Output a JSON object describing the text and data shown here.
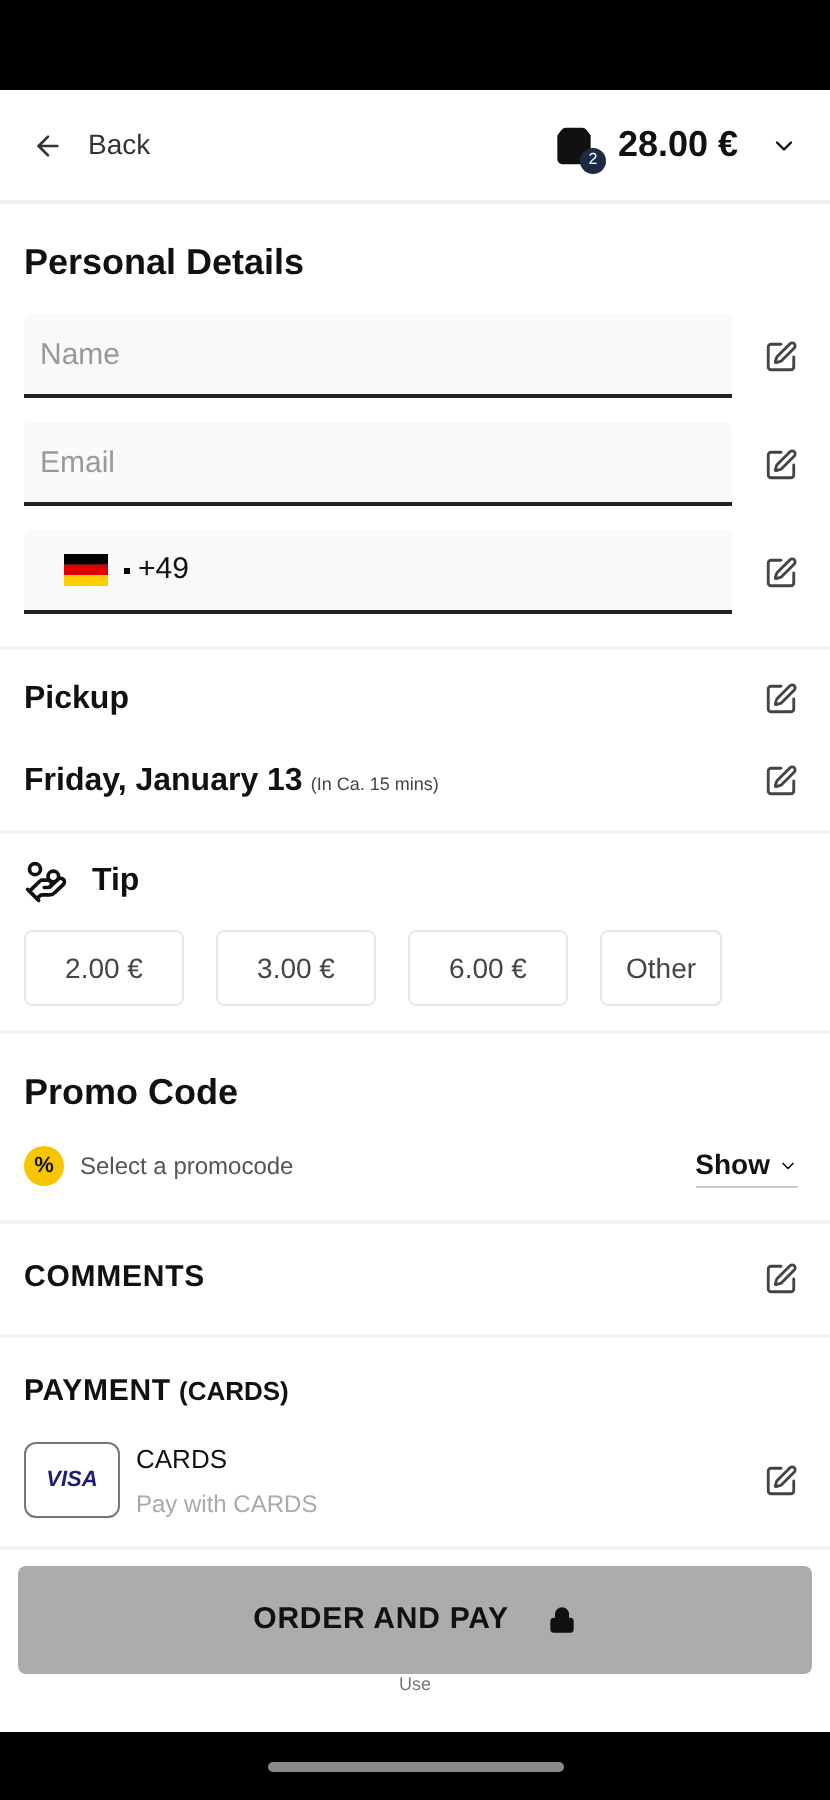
{
  "header": {
    "back": "Back",
    "cart_count": "2",
    "total": "28.00 €"
  },
  "personal": {
    "title": "Personal Details",
    "fields": [
      {
        "kind": "text",
        "placeholder": "Name"
      },
      {
        "kind": "text",
        "placeholder": "Email"
      },
      {
        "kind": "phone",
        "value": "+49"
      }
    ]
  },
  "pickup": {
    "title": "Pickup",
    "date": "Friday, January 13",
    "eta": "(In Ca. 15 mins)"
  },
  "tip": {
    "title": "Tip",
    "options": [
      {
        "label": "2.00 €",
        "selected": false
      },
      {
        "label": "3.00 €",
        "selected": false
      },
      {
        "label": "6.00 €",
        "selected": false
      },
      {
        "label": "Other",
        "selected": false
      }
    ]
  },
  "promo": {
    "title": "Promo Code",
    "badge": "%",
    "hint": "Select a promocode",
    "show": "Show"
  },
  "comments": {
    "title": "COMMENTS"
  },
  "payment": {
    "title": "PAYMENT",
    "title_suffix": "(CARDS)",
    "logo": "VISA",
    "method": "CARDS",
    "subtitle": "Pay with CARDS"
  },
  "order_button": {
    "label": "ORDER AND PAY",
    "disabled": true
  },
  "footer_text": "Use"
}
